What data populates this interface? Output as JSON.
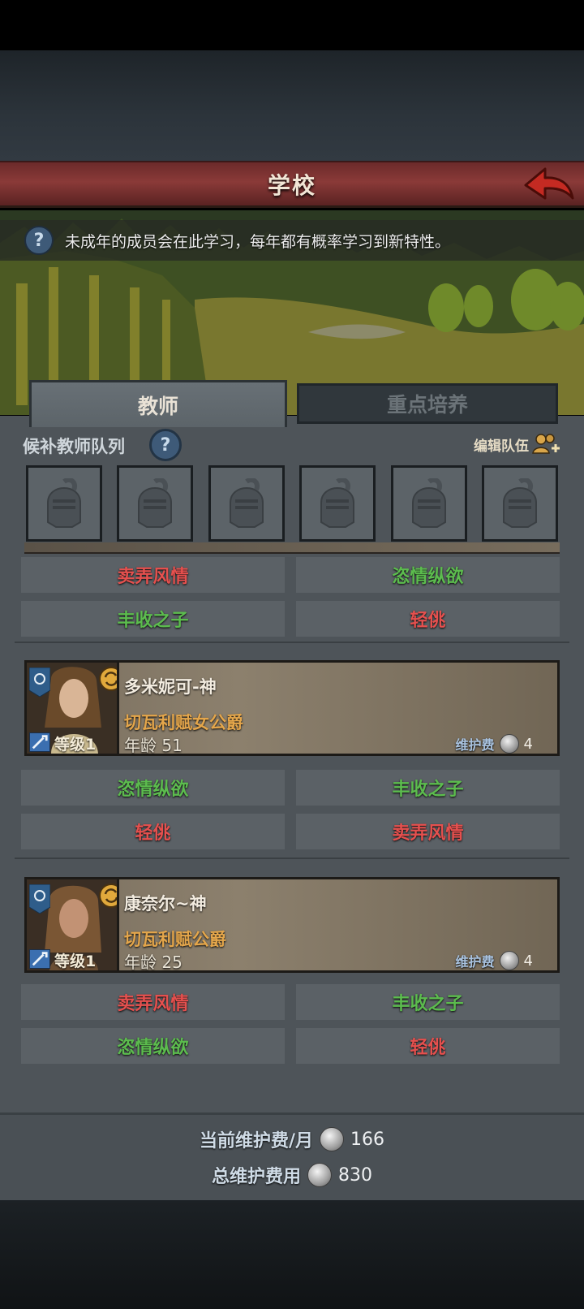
{
  "header": {
    "title": "学校"
  },
  "info": {
    "text": "未成年的成员会在此学习，每年都有概率学习到新特性。"
  },
  "tabs": [
    {
      "label": "教师"
    },
    {
      "label": "重点培养"
    }
  ],
  "queue": {
    "label": "候补教师队列",
    "edit_label": "编辑队伍",
    "slots": 6
  },
  "colors": {
    "trait_negative": "#e5504e",
    "trait_positive": "#5cbc4e",
    "title_orange": "#e4a64b"
  },
  "groups": [
    {
      "traits": [
        {
          "label": "卖弄风情",
          "tone": "negative"
        },
        {
          "label": "恣情纵欲",
          "tone": "positive"
        },
        {
          "label": "丰收之子",
          "tone": "positive"
        },
        {
          "label": "轻佻",
          "tone": "negative"
        }
      ]
    },
    {
      "member": {
        "name": "多米妮可-神",
        "title": "切瓦利赋女公爵",
        "age_label": "年龄",
        "age": "51",
        "level": "等级1",
        "upkeep_label": "维护费",
        "upkeep": "4"
      },
      "traits": [
        {
          "label": "恣情纵欲",
          "tone": "positive"
        },
        {
          "label": "丰收之子",
          "tone": "positive"
        },
        {
          "label": "轻佻",
          "tone": "negative"
        },
        {
          "label": "卖弄风情",
          "tone": "negative"
        }
      ]
    },
    {
      "member": {
        "name": "康奈尔~神",
        "title": "切瓦利赋公爵",
        "age_label": "年龄",
        "age": "25",
        "level": "等级1",
        "upkeep_label": "维护费",
        "upkeep": "4"
      },
      "traits": [
        {
          "label": "卖弄风情",
          "tone": "negative"
        },
        {
          "label": "丰收之子",
          "tone": "positive"
        },
        {
          "label": "恣情纵欲",
          "tone": "positive"
        },
        {
          "label": "轻佻",
          "tone": "negative"
        }
      ]
    }
  ],
  "footer": {
    "monthly_label": "当前维护费/月",
    "monthly_value": "166",
    "total_label": "总维护费用",
    "total_value": "830"
  }
}
